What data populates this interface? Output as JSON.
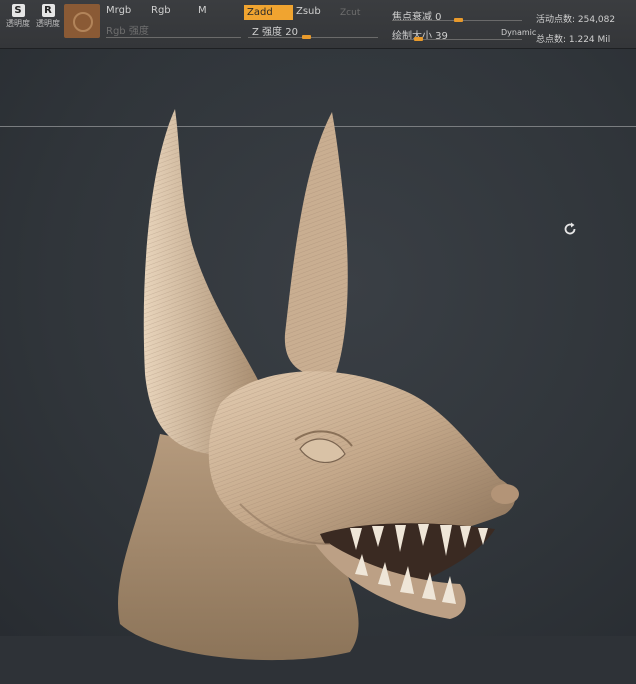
{
  "toolbar": {
    "btn1": {
      "glyph": "S",
      "label": "透明度"
    },
    "btn2": {
      "glyph": "R",
      "label": "透明度"
    },
    "mrgb": "Mrgb",
    "rgb": "Rgb",
    "m": "M",
    "rgb_intensity": "Rgb 强度",
    "zadd": "Zadd",
    "zsub": "Zsub",
    "zcut": "Zcut",
    "z_intensity": "Z 强度 20",
    "focal_shift": "焦点衰减 0",
    "draw_size": "绘制大小 39",
    "dynamic": "Dynamic",
    "active_points": "活动点数: 254,082",
    "total_points": "总点数: 1.224 Mil"
  },
  "viewport": {
    "model": "sculpted jackal head",
    "rotate_icon": "rotate-icon"
  }
}
